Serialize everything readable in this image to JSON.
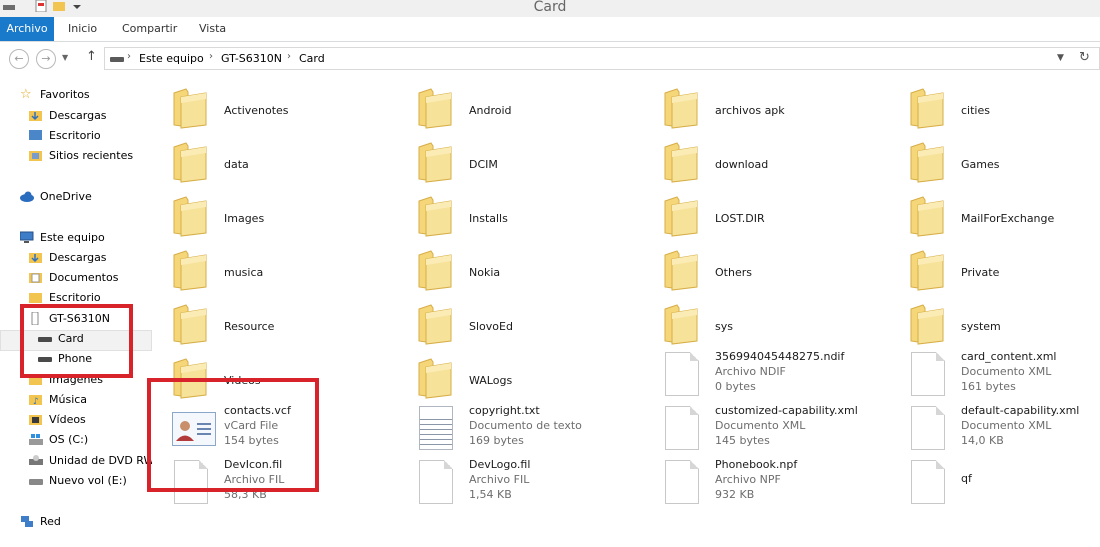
{
  "window": {
    "title": "Card"
  },
  "ribbon": {
    "tabs": [
      "Archivo",
      "Inicio",
      "Compartir",
      "Vista"
    ]
  },
  "address": {
    "breadcrumbs": [
      "Este equipo",
      "GT-S6310N",
      "Card"
    ]
  },
  "nav": {
    "favorites": {
      "label": "Favoritos",
      "items": [
        "Descargas",
        "Escritorio",
        "Sitios recientes"
      ]
    },
    "onedrive": "OneDrive",
    "this_pc": {
      "label": "Este equipo",
      "items": [
        "Descargas",
        "Documentos",
        "Escritorio",
        "GT-S6310N",
        "Card",
        "Phone",
        "Imágenes",
        "Música",
        "Vídeos",
        "OS (C:)",
        "Unidad de DVD RW",
        "Nuevo vol (E:)"
      ]
    },
    "network": "Red"
  },
  "folders": [
    "Activenotes",
    "Android",
    "archivos apk",
    "cities",
    "data",
    "DCIM",
    "download",
    "Games",
    "Images",
    "Installs",
    "LOST.DIR",
    "MailForExchange",
    "musica",
    "Nokia",
    "Others",
    "Private",
    "Resource",
    "SlovoEd",
    "sys",
    "system",
    "Videos",
    "WALogs"
  ],
  "files": [
    {
      "name": "356994045448275.ndif",
      "type": "Archivo NDIF",
      "size": "0 bytes",
      "icon": "blank-document-icon"
    },
    {
      "name": "card_content.xml",
      "type": "Documento XML",
      "size": "161 bytes",
      "icon": "blank-document-icon"
    },
    {
      "name": "contacts.vcf",
      "type": "vCard File",
      "size": "154 bytes",
      "icon": "vcard-icon"
    },
    {
      "name": "copyright.txt",
      "type": "Documento de texto",
      "size": "169 bytes",
      "icon": "text-document-icon"
    },
    {
      "name": "customized-capability.xml",
      "type": "Documento XML",
      "size": "145 bytes",
      "icon": "blank-document-icon"
    },
    {
      "name": "default-capability.xml",
      "type": "Documento XML",
      "size": "14,0 KB",
      "icon": "blank-document-icon"
    },
    {
      "name": "DevIcon.fil",
      "type": "Archivo FIL",
      "size": "58,3 KB",
      "icon": "blank-document-icon"
    },
    {
      "name": "DevLogo.fil",
      "type": "Archivo FIL",
      "size": "1,54 KB",
      "icon": "blank-document-icon"
    },
    {
      "name": "Phonebook.npf",
      "type": "Archivo NPF",
      "size": "932 KB",
      "icon": "blank-document-icon"
    },
    {
      "name": "qf",
      "type": "",
      "size": "",
      "icon": "blank-document-icon"
    }
  ],
  "colors": {
    "accent": "#1979ca",
    "highlight": "#d8232a",
    "folder": "#f5d679"
  }
}
